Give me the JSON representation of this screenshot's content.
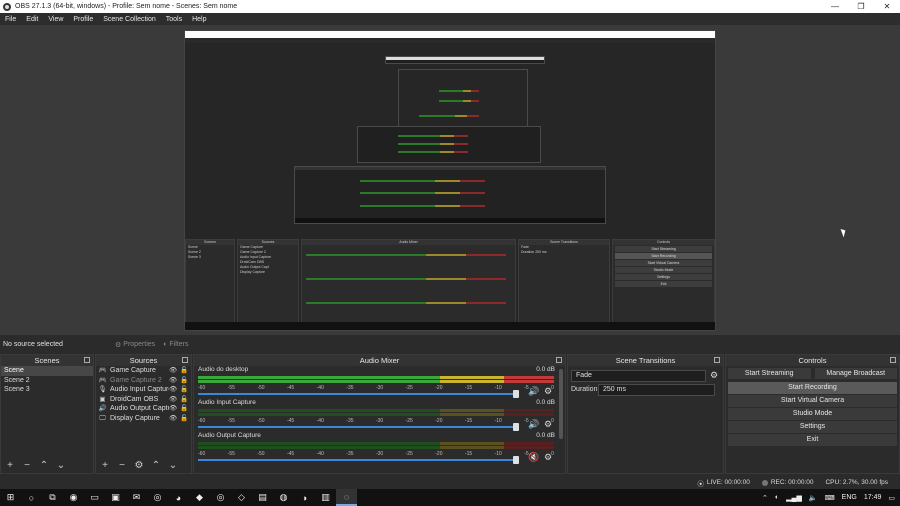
{
  "window": {
    "title": "OBS 27.1.3 (64-bit, windows) - Profile: Sem nome - Scenes: Sem nome",
    "minimize": "—",
    "maximize": "❐",
    "close": "✕"
  },
  "menu": [
    "File",
    "Edit",
    "View",
    "Profile",
    "Scene Collection",
    "Tools",
    "Help"
  ],
  "source_toolbar": {
    "no_source": "No source selected",
    "properties": "Properties",
    "filters": "Filters"
  },
  "scenes": {
    "header": "Scenes",
    "items": [
      "Scene",
      "Scene 2",
      "Scene 3"
    ],
    "selected_index": 0
  },
  "sources": {
    "header": "Sources",
    "items": [
      {
        "name": "Game Capture",
        "icon": "gamepad-icon",
        "glyph": "🎮",
        "visible": true
      },
      {
        "name": "Game Capture 2",
        "icon": "gamepad-icon",
        "glyph": "🎮",
        "visible": true,
        "dim": true
      },
      {
        "name": "Audio Input Capture",
        "icon": "microphone-icon",
        "glyph": "🎙",
        "visible": true
      },
      {
        "name": "DroidCam OBS",
        "icon": "camera-icon",
        "glyph": "▣",
        "visible": true
      },
      {
        "name": "Audio Output Captu",
        "icon": "speaker-icon",
        "glyph": "🔊",
        "visible": true
      },
      {
        "name": "Display Capture",
        "icon": "monitor-icon",
        "glyph": "🖵",
        "visible": true
      }
    ]
  },
  "mixer": {
    "header": "Audio Mixer",
    "ticks": [
      "-60",
      "-55",
      "-50",
      "-45",
      "-40",
      "-35",
      "-30",
      "-25",
      "-20",
      "-15",
      "-10",
      "-5",
      "0"
    ],
    "channels": [
      {
        "name": "Audio do desktop",
        "db": "0.0 dB",
        "muted": false,
        "volume": 1.0
      },
      {
        "name": "Audio Input Capture",
        "db": "0.0 dB",
        "muted": false,
        "volume": 1.0
      },
      {
        "name": "Audio Output Capture",
        "db": "0.0 dB",
        "muted": true,
        "volume": 1.0
      }
    ]
  },
  "transitions": {
    "header": "Scene Transitions",
    "selected": "Fade",
    "duration_label": "Duration",
    "duration_value": "250 ms"
  },
  "controls": {
    "header": "Controls",
    "start_streaming": "Start Streaming",
    "manage_broadcast": "Manage Broadcast",
    "start_recording": "Start Recording",
    "start_virtual_camera": "Start Virtual Camera",
    "studio_mode": "Studio Mode",
    "settings": "Settings",
    "exit": "Exit"
  },
  "status": {
    "live": "LIVE: 00:00:00",
    "rec": "REC: 00:00:00",
    "cpu": "CPU: 2.7%, 30.00 fps"
  },
  "taskbar": {
    "lang": "ENG",
    "time": "17:49"
  },
  "colors": {
    "meter_green": "#3aa83a",
    "meter_yellow": "#c9b52e",
    "meter_red": "#c23a3a",
    "slider_blue": "#3b87d9"
  }
}
